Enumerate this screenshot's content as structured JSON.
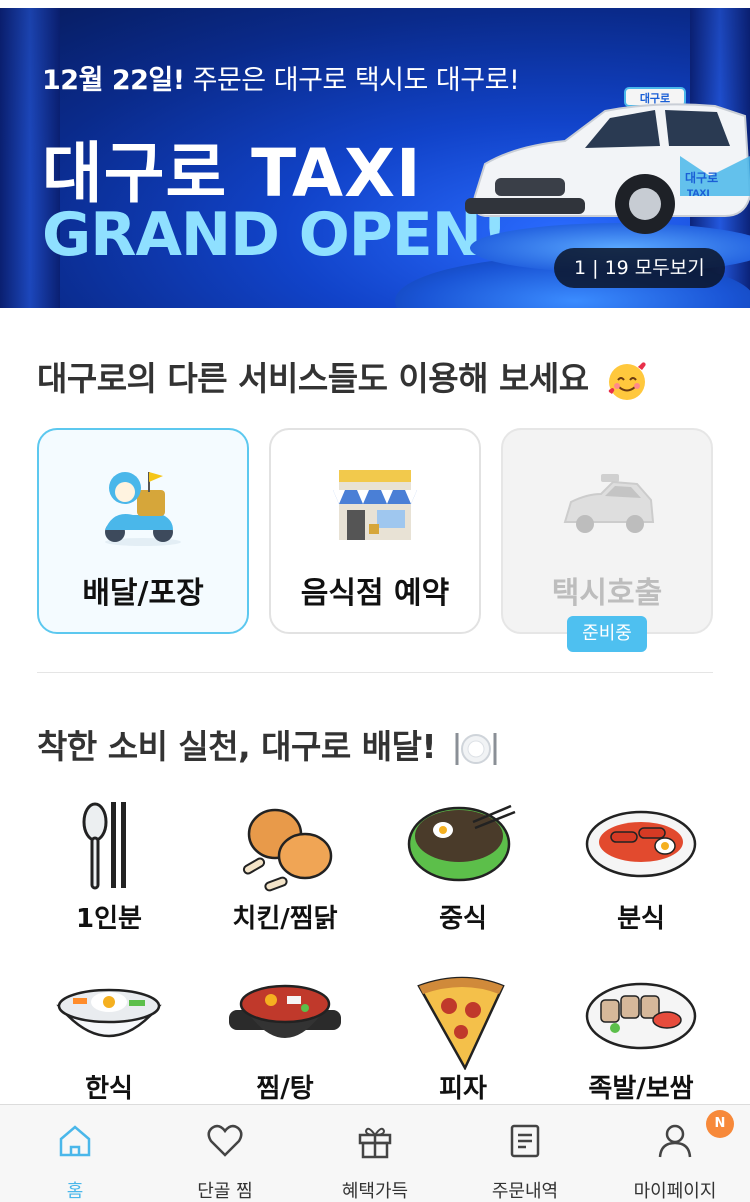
{
  "banner": {
    "subtitle_bold": "12월 22일!",
    "subtitle_rest": " 주문은 대구로 택시도 대구로!",
    "title_line1": "대구로 TAXI",
    "title_line2": "GRAND OPEN!",
    "taxi_sign": "대구로",
    "taxi_door_logo": "대구로",
    "taxi_door_sub": "TAXI",
    "counter": "1 | 19 모두보기"
  },
  "services": {
    "title": "대구로의 다른 서비스들도 이용해 보세요",
    "title_emoji": "smiling-face-with-hearts-icon",
    "cards": [
      {
        "label": "배달/포장",
        "icon": "delivery-scooter-icon",
        "state": "active"
      },
      {
        "label": "음식점 예약",
        "icon": "restaurant-store-icon",
        "state": "normal"
      },
      {
        "label": "택시호출",
        "icon": "taxi-car-icon",
        "state": "disabled"
      }
    ],
    "badge": "준비중"
  },
  "delivery": {
    "title": "착한 소비 실천, 대구로 배달!",
    "title_emoji": "fork-plate-knife-icon",
    "categories": [
      {
        "label": "1인분",
        "icon": "spoon-chopsticks-icon"
      },
      {
        "label": "치킨/찜닭",
        "icon": "chicken-icon"
      },
      {
        "label": "중식",
        "icon": "jajangmyeon-icon"
      },
      {
        "label": "분식",
        "icon": "tteokbokki-icon"
      },
      {
        "label": "한식",
        "icon": "bibimbap-icon"
      },
      {
        "label": "찜/탕",
        "icon": "stew-pot-icon"
      },
      {
        "label": "피자",
        "icon": "pizza-icon"
      },
      {
        "label": "족발/보쌈",
        "icon": "bossam-icon"
      }
    ]
  },
  "nav": {
    "items": [
      {
        "label": "홈",
        "icon": "home-icon",
        "active": true
      },
      {
        "label": "단골 찜",
        "icon": "heart-icon",
        "active": false
      },
      {
        "label": "혜택가득",
        "icon": "gift-icon",
        "active": false
      },
      {
        "label": "주문내역",
        "icon": "receipt-icon",
        "active": false
      },
      {
        "label": "마이페이지",
        "icon": "person-icon",
        "active": false
      }
    ],
    "mypage_badge": "N"
  },
  "colors": {
    "accent": "#4ab7ea",
    "banner_blue": "#1143c9",
    "badge_orange": "#f7893a",
    "active_card_border": "#5cc8ef"
  }
}
